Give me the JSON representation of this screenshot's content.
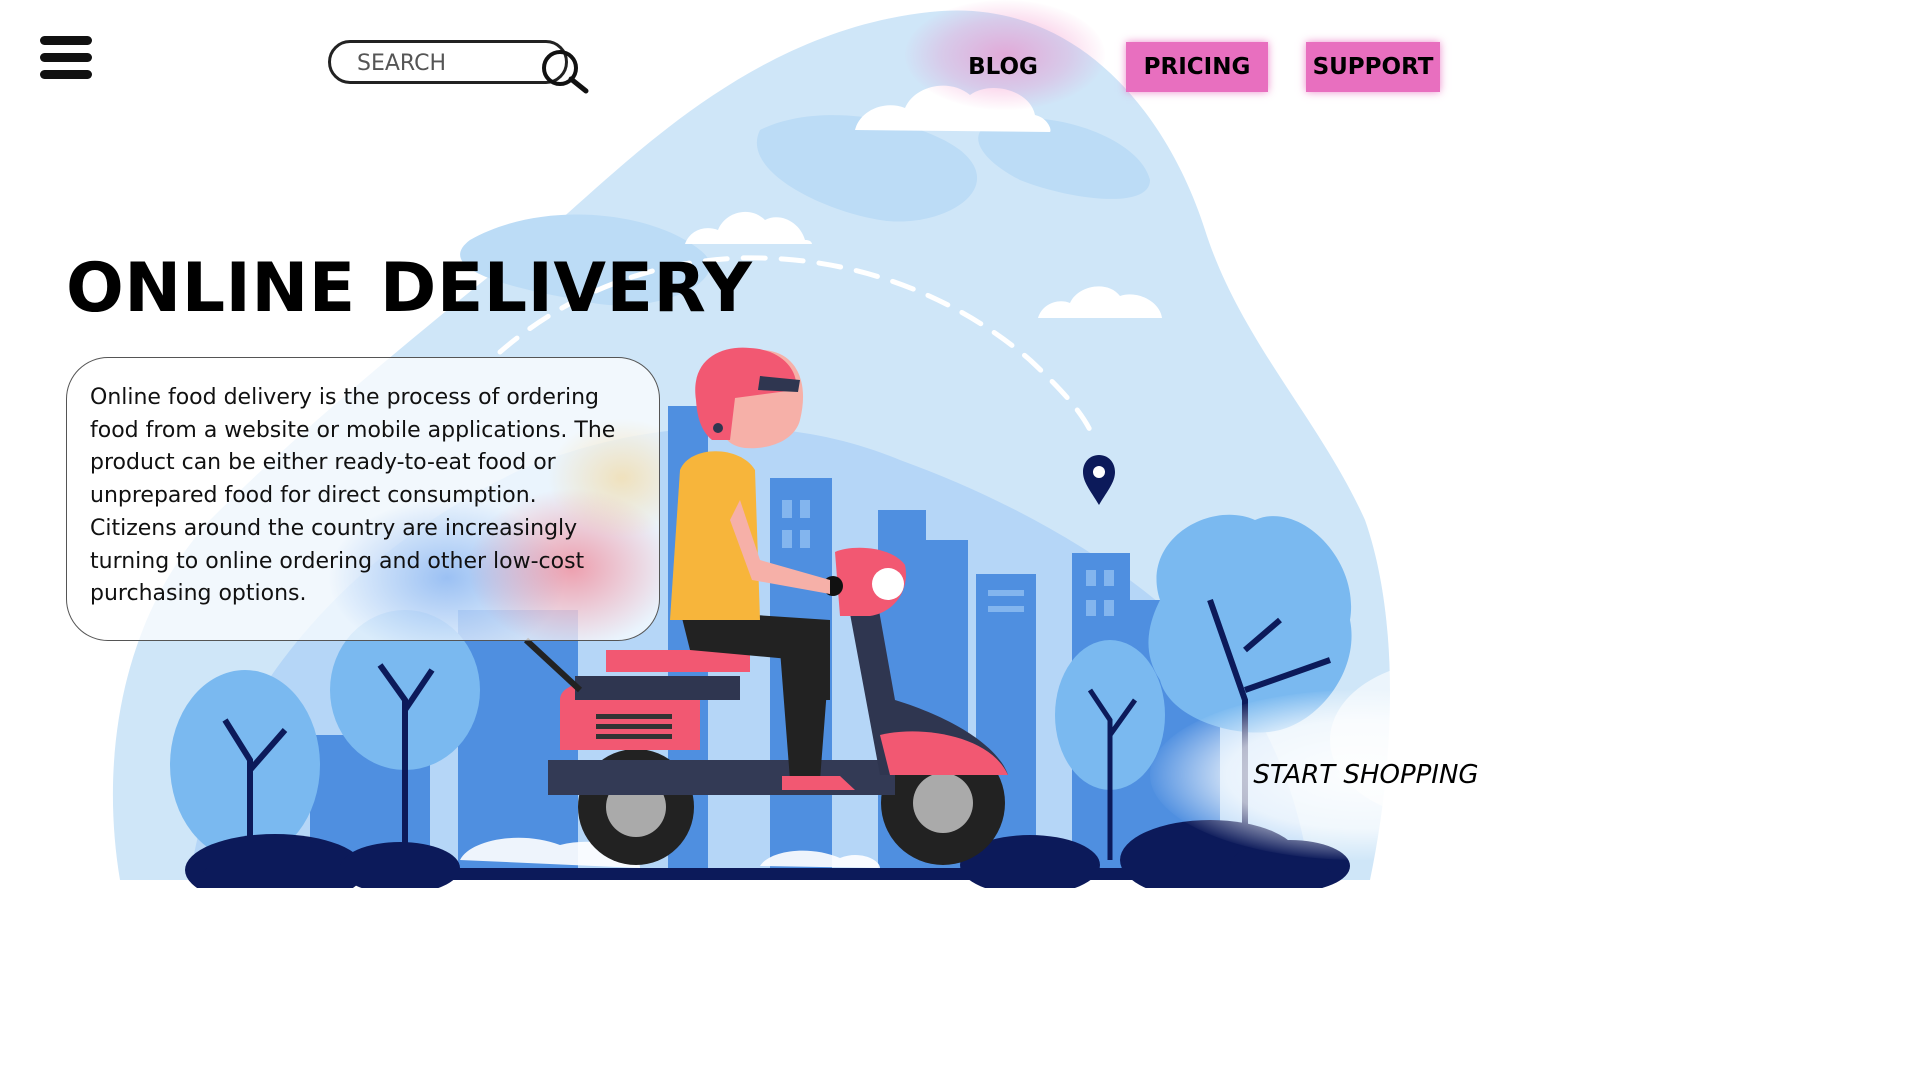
{
  "header": {
    "menu_icon": "hamburger-menu-icon",
    "search": {
      "placeholder": "SEARCH",
      "value": "",
      "icon": "search-icon"
    },
    "nav": [
      {
        "label": "BLOG"
      },
      {
        "label": "PRICING"
      },
      {
        "label": "SUPPORT"
      }
    ]
  },
  "hero": {
    "title": "ONLINE DELIVERY",
    "description": "Online food delivery is the process of ordering food from a website or mobile applications. The product can be either ready-to-eat food or unprepared food for direct consumption. Citizens around the country are increasingly turning to online ordering and other low-cost purchasing options.",
    "cta_label": "START SHOPPING"
  },
  "colors": {
    "accent_pink": "#e86fbf",
    "sky_blue": "#cfe6f8",
    "city_blue": "#4f8fe0",
    "navy": "#0c1a5a",
    "scooter_red": "#f25872",
    "shirt_yellow": "#f7b53b"
  }
}
